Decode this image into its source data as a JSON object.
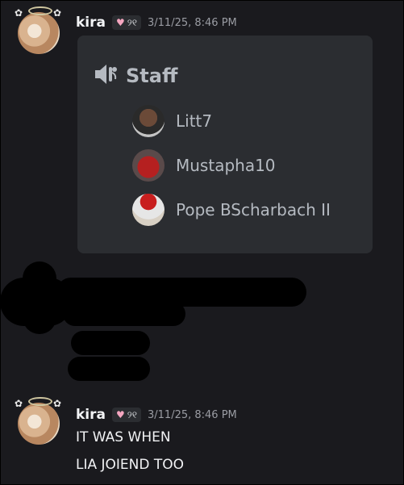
{
  "messages": [
    {
      "author": "kira",
      "tag": "୨୧",
      "timestamp": "3/11/25, 8:46 PM",
      "embed": {
        "title": "Staff",
        "members": [
          {
            "name": "Litt7"
          },
          {
            "name": "Mustapha10"
          },
          {
            "name": "Pope BScharbach II"
          }
        ]
      }
    },
    {
      "author": "kira",
      "tag": "୨୧",
      "timestamp": "3/11/25, 8:46 PM",
      "lines": [
        "IT WAS WHEN",
        "LIA JOIEND TOO"
      ]
    }
  ],
  "colors": {
    "background": "#1a1a1e",
    "card": "#2b2d31",
    "muted_text": "#b5bac1",
    "timestamp": "#9a9ca3"
  }
}
